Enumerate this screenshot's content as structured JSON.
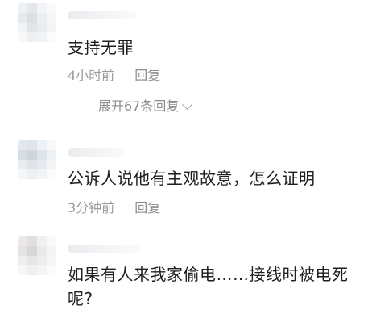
{
  "comments": [
    {
      "text": "支持无罪",
      "time": "4小时前",
      "reply_label": "回复",
      "expand_label": "展开67条回复"
    },
    {
      "text": "公诉人说他有主观故意，怎么证明",
      "time": "3分钟前",
      "reply_label": "回复"
    },
    {
      "text": "如果有人来我家偷电……接线时被电死呢?"
    }
  ],
  "icons": {
    "expand": "chevron-down-icon"
  },
  "colors": {
    "text": "#1e1e1e",
    "meta": "#9b9b9b",
    "background": "#ffffff"
  }
}
